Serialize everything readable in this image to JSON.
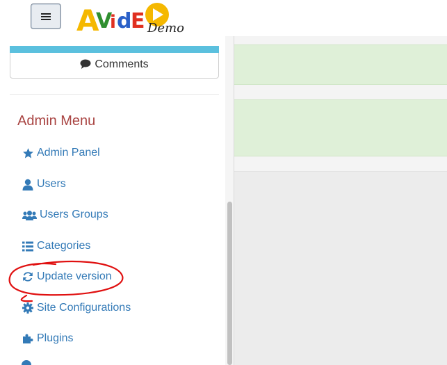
{
  "header": {
    "menu_toggle_label": "",
    "logo_text": "AVidEO",
    "logo_sub": "Demo"
  },
  "sidebar": {
    "comments_label": "Comments",
    "admin_title": "Admin Menu",
    "items": [
      {
        "label": "Admin Panel",
        "icon": "star-icon"
      },
      {
        "label": "Users",
        "icon": "user-icon"
      },
      {
        "label": "Users Groups",
        "icon": "users-icon"
      },
      {
        "label": "Categories",
        "icon": "list-icon"
      },
      {
        "label": "Update version",
        "icon": "refresh-icon"
      },
      {
        "label": "Site Configurations",
        "icon": "gear-icon"
      },
      {
        "label": "Plugins",
        "icon": "puzzle-icon"
      }
    ]
  },
  "colors": {
    "link": "#337ab7",
    "admin_title": "#a94442",
    "panel_accent": "#5bc0de",
    "alert_green": "#dff0d8",
    "annotation_red": "#e01010"
  }
}
